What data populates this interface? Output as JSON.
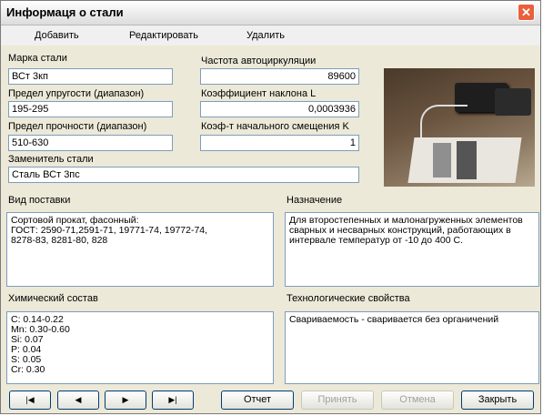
{
  "window": {
    "title": "Информаця о стали",
    "close_glyph": "✕"
  },
  "menu": {
    "add": "Добавить",
    "edit": "Редактировать",
    "delete": "Удалить"
  },
  "fields": {
    "grade_label": "Марка стали",
    "grade_value": "ВСт 3кп",
    "elasticity_label": "Предел упругости (диапазон)",
    "elasticity_value": "195-295",
    "strength_label": "Предел прочности (диапазон)",
    "strength_value": "510-630",
    "substitute_label": "Заменитель стали",
    "substitute_value": "Сталь ВСт 3пс",
    "frequency_label": "Частота автоциркуляции",
    "frequency_value": "89600",
    "slope_label": "Коэффициент наклона L",
    "slope_value": "0,0003936",
    "offset_label": "Коэф-т начального смещения K",
    "offset_value": "1"
  },
  "sections": {
    "supply_label": "Вид поставки",
    "supply_text": "Сортовой прокат, фасонный:\nГОСТ: 2590-71,2591-71, 19771-74, 19772-74,\n8278-83, 8281-80, 828",
    "purpose_label": "Назначение",
    "purpose_text": "Для второстепенных и малонагруженных элементов\nсварных и несварных конструкций, работающих в\nинтервале температур от -10 до 400 С.",
    "chemical_label": "Химический состав",
    "chemical_text": "C: 0.14-0.22\nMn: 0.30-0.60\nSi: 0.07\nP: 0.04\nS: 0.05\nCr: 0.30",
    "tech_label": "Технологические свойства",
    "tech_text": "Свариваемость - сваривается без органичений"
  },
  "buttons": {
    "first": "|◀",
    "prev": "◀",
    "next": "▶",
    "last": "▶|",
    "report": "Отчет",
    "accept": "Принять",
    "cancel": "Отмена",
    "close": "Закрыть"
  }
}
